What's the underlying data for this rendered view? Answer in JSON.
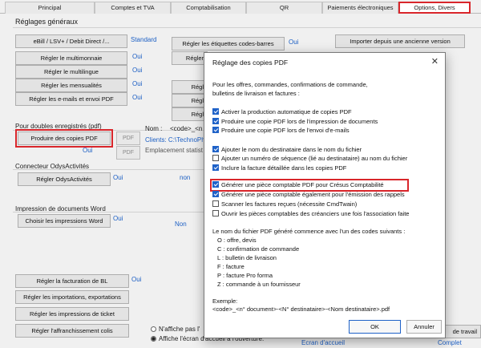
{
  "tabs": [
    {
      "label": "Principal",
      "active": false
    },
    {
      "label": "Comptes et TVA",
      "active": false
    },
    {
      "label": "Comptabilisation",
      "active": false
    },
    {
      "label": "QR",
      "active": false
    },
    {
      "label": "Paiements électroniques",
      "active": false
    },
    {
      "label": "Options, Divers",
      "active": true
    }
  ],
  "general": {
    "title": "Réglages généraux",
    "buttons": [
      "eBill / LSV+ / Debit Direct /...",
      "Régler le multimonnaie",
      "Régler le multilingue",
      "Régler les mensualités",
      "Régler les e-mails et envoi PDF"
    ],
    "values": [
      "Standard",
      "Oui",
      "Oui",
      "Oui",
      "Oui"
    ],
    "mid_buttons": [
      "Régler les étiquettes codes-barres",
      "Régler",
      "Régl",
      "Régl",
      "Régl",
      "Régl"
    ],
    "mid_values": [
      "Oui"
    ],
    "import_button": "Importer depuis une ancienne version"
  },
  "pdf_section": {
    "title": "Pour doubles enregistrés (pdf)",
    "button": "Produire des copies PDF",
    "value": "Oui",
    "pdf_icon_label": "PDF",
    "name_label": "Nom :",
    "name_value": "<code>_<n",
    "clients_value": "Clients: C:\\TechnoPh",
    "location_value": "Emplacement statist"
  },
  "odys": {
    "title": "Connecteur OdysActivités",
    "button": "Régler OdysActivités",
    "value": "Oui",
    "value2": "non"
  },
  "word": {
    "title": "Impression de documents Word",
    "button": "Choisir les impressions Word",
    "value": "Oui",
    "value2": "Non"
  },
  "bottom": {
    "buttons": [
      "Régler la  facturation de BL",
      "Régler les importations, exportations",
      "Régler les impressions de ticket",
      "Régler l'affranchissement colis"
    ],
    "value": "Oui",
    "radio1": "N'affiche pas l'",
    "radio2": "Affiche l'écran d'accueil à l'ouverture.",
    "link1": "Ecran d'accueil",
    "link2": "Complet",
    "right_button": "de travail"
  },
  "dialog": {
    "title": "Réglage des copies PDF",
    "close": "✕",
    "intro1": "Pour les offres, commandes, confirmations de commande,",
    "intro2": "bulletins de livraison et factures :",
    "group1": [
      {
        "label": "Activer la production automatique de copies PDF",
        "checked": true
      },
      {
        "label": "Produire une copie PDF lors de l'impression de documents",
        "checked": true
      },
      {
        "label": "Produire une copie PDF lors de l'envoi d'e-mails",
        "checked": true
      }
    ],
    "group2": [
      {
        "label": "Ajouter le nom du destinataire dans le nom du fichier",
        "checked": true
      },
      {
        "label": "Ajouter un numéro de séquence (lié au destinataire) au nom du fichier",
        "checked": false
      },
      {
        "label": "Inclure la facture détaillée dans les copies PDF",
        "checked": true
      }
    ],
    "group3": [
      {
        "label": "Générer une pièce comptable PDF pour Crésus Comptabilité",
        "checked": true
      },
      {
        "label": "Générer une pièce comptable également pour l'émission des rappels",
        "checked": true
      },
      {
        "label": "Scanner les factures reçues (nécessite CmdTwain)",
        "checked": false
      },
      {
        "label": "Ouvrir les pièces comptables des créanciers une fois l'association faite",
        "checked": false
      }
    ],
    "codes_intro": "Le nom du fichier PDF généré commence avec l'un des codes suivants :",
    "codes": [
      "O : offre, devis",
      "C : confirmation de commande",
      "L : bulletin de livraison",
      "F : facture",
      "P : facture Pro forma",
      "Z : commande à un fournisseur"
    ],
    "example_label": "Exemple:",
    "example": "<code>_<n° document>-<N° destinataire>-<Nom destinataire>.pdf",
    "ok": "OK",
    "cancel": "Annuler"
  },
  "colors": {
    "accent": "#1f62c8",
    "highlight": "#d9262b",
    "link": "#1c5fc4"
  }
}
